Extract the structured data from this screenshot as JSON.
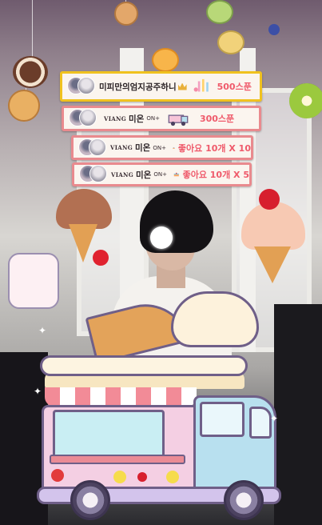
{
  "gifts": [
    {
      "nickname": "미피만의엄지공주하니",
      "brand": "",
      "badge": "",
      "has_crown": true,
      "amount": "500스푼",
      "highlight": "gold"
    },
    {
      "nickname": "미온",
      "brand": "VIANG",
      "badge": "ON+",
      "has_crown": false,
      "amount": "300스푼",
      "highlight": "pink"
    },
    {
      "nickname": "미온",
      "brand": "VIANG",
      "badge": "ON+",
      "has_crown": false,
      "amount": "좋아요 10개 X 10",
      "highlight": "pink"
    },
    {
      "nickname": "미온",
      "brand": "VIANG",
      "badge": "ON+",
      "has_crown": false,
      "amount": "좋아요 10개 X 5",
      "highlight": "pink"
    }
  ],
  "colors": {
    "gold_border": "#f0c21f",
    "pink_border": "#e98a8e",
    "amount_text": "#ef5a6b",
    "truck_outline": "#6f5f88"
  },
  "icons": [
    "cupcake-gift-icon",
    "ice-cream-truck-gift-icon",
    "cake-gift-icon",
    "crown-icon"
  ]
}
